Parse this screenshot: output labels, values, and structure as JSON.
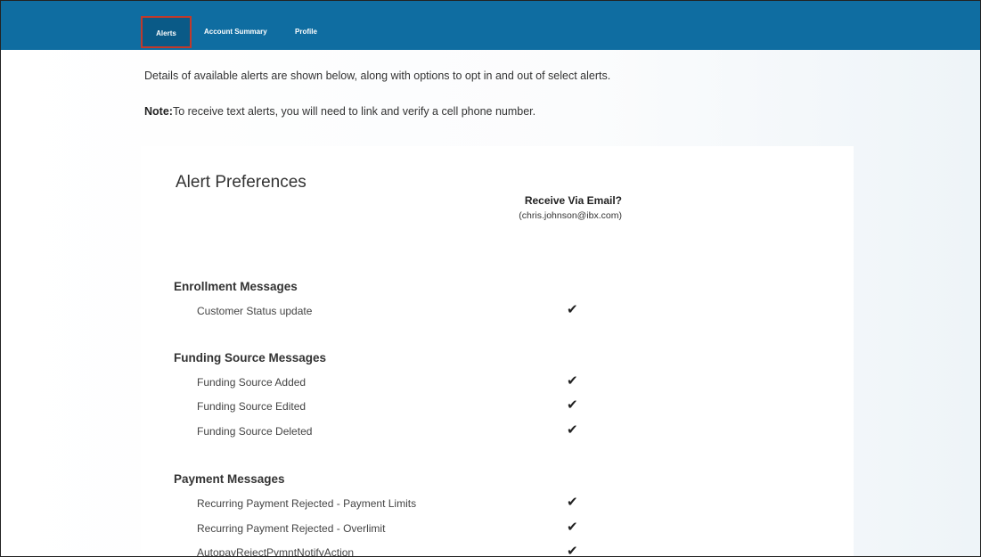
{
  "nav": {
    "tabs": [
      {
        "label": "Alerts",
        "active": true
      },
      {
        "label": "Account Summary",
        "active": false
      },
      {
        "label": "Profile",
        "active": false
      }
    ]
  },
  "intro_text": "Details of available alerts are shown below, along with options to opt in and out of select alerts.",
  "note": {
    "label": "Note:",
    "text": "To receive text alerts, you will need to link and verify a cell phone number."
  },
  "preferences": {
    "title": "Alert Preferences",
    "column_header": "Receive Via Email?",
    "email": "(chris.johnson@ibx.com)",
    "check_glyph": "✔",
    "sections": [
      {
        "title": "Enrollment Messages",
        "rows": [
          {
            "label": "Customer Status update",
            "email": true
          }
        ]
      },
      {
        "title": "Funding Source Messages",
        "rows": [
          {
            "label": "Funding Source Added",
            "email": true
          },
          {
            "label": "Funding Source Edited",
            "email": true
          },
          {
            "label": "Funding Source Deleted",
            "email": true
          }
        ]
      },
      {
        "title": "Payment Messages",
        "rows": [
          {
            "label": "Recurring Payment Rejected - Payment Limits",
            "email": true
          },
          {
            "label": "Recurring Payment Rejected - Overlimit",
            "email": true
          },
          {
            "label": "AutopayRejectPymntNotifyAction",
            "email": true
          }
        ]
      }
    ]
  },
  "colors": {
    "nav_bg": "#0f6da1",
    "active_border": "#c0392b"
  }
}
